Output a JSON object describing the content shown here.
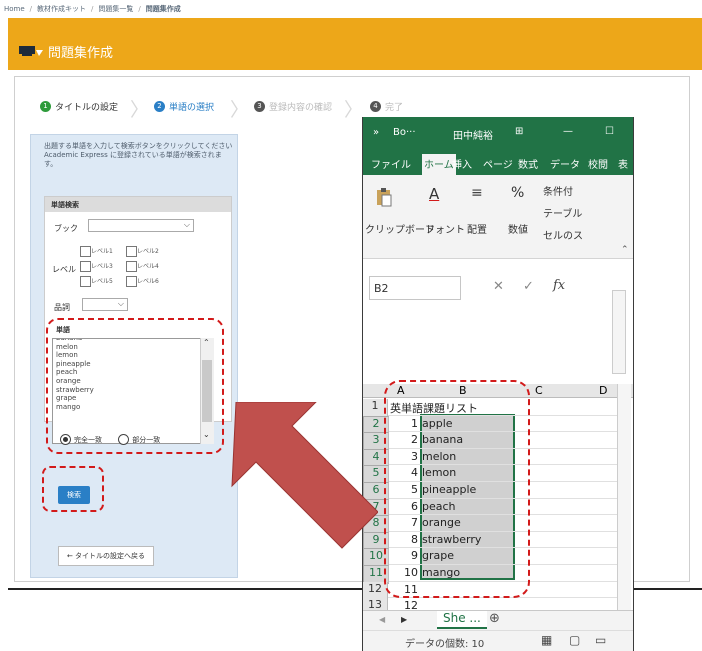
{
  "breadcrumb": [
    "Home",
    "教材作成キット",
    "問題集一覧",
    "問題集作成"
  ],
  "header": {
    "title": "問題集作成",
    "bg": "#eda719"
  },
  "steps": [
    {
      "num": "1",
      "label": "タイトルの設定",
      "state": "done"
    },
    {
      "num": "2",
      "label": "単語の選択",
      "state": "current"
    },
    {
      "num": "3",
      "label": "登録内容の確認",
      "state": "todo"
    },
    {
      "num": "4",
      "label": "完了",
      "state": "todo"
    }
  ],
  "left_panel": {
    "instructions": "出題する単語を入力して検索ボタンをクリックしてください\nAcademic Express に登録されている単語が検索されます。",
    "search_header": "単語検索",
    "book_label": "ブック",
    "level_label": "レベル",
    "levels": [
      "レベル1",
      "レベル2",
      "レベル3",
      "レベル4",
      "レベル5",
      "レベル6"
    ],
    "pos_label": "品詞",
    "word_label": "単語",
    "words": [
      "banana",
      "melon",
      "lemon",
      "pineapple",
      "peach",
      "orange",
      "strawberry",
      "grape",
      "mango"
    ],
    "match_exact": "完全一致",
    "match_partial": "部分一致",
    "search_button": "検索",
    "back_button": "← タイトルの設定へ戻る"
  },
  "excel": {
    "title_items": [
      "»",
      "Bo···",
      "田中純裕",
      "⊞",
      "—",
      "☐"
    ],
    "tabs": [
      "ファイル",
      "ホーム",
      "挿入",
      "ページ",
      "数式",
      "データ",
      "校閲",
      "表"
    ],
    "active_tab": "ホーム",
    "ribbon": {
      "clipboard": "クリップボード",
      "font": "フォント",
      "align": "配置",
      "number": "数値",
      "cond": "条件付",
      "table": "テーブル",
      "cellstyle": "セルのス"
    },
    "name_box": "B2",
    "col_headers": [
      "A",
      "B",
      "C",
      "D"
    ],
    "rows": [
      {
        "r": "1",
        "a": "",
        "b": "英単語課題リスト"
      },
      {
        "r": "2",
        "a": "1",
        "b": "apple"
      },
      {
        "r": "3",
        "a": "2",
        "b": "banana"
      },
      {
        "r": "4",
        "a": "3",
        "b": "melon"
      },
      {
        "r": "5",
        "a": "4",
        "b": "lemon"
      },
      {
        "r": "6",
        "a": "5",
        "b": "pineapple"
      },
      {
        "r": "7",
        "a": "6",
        "b": "peach"
      },
      {
        "r": "8",
        "a": "7",
        "b": "orange"
      },
      {
        "r": "9",
        "a": "8",
        "b": "strawberry"
      },
      {
        "r": "10",
        "a": "9",
        "b": "grape"
      },
      {
        "r": "11",
        "a": "10",
        "b": "mango"
      },
      {
        "r": "12",
        "a": "11",
        "b": ""
      },
      {
        "r": "13",
        "a": "12",
        "b": ""
      }
    ],
    "sheet_tab": "She ...",
    "status_text": "データの個数: 10",
    "accent": "#217346"
  },
  "arrow_color": "#c0504d"
}
